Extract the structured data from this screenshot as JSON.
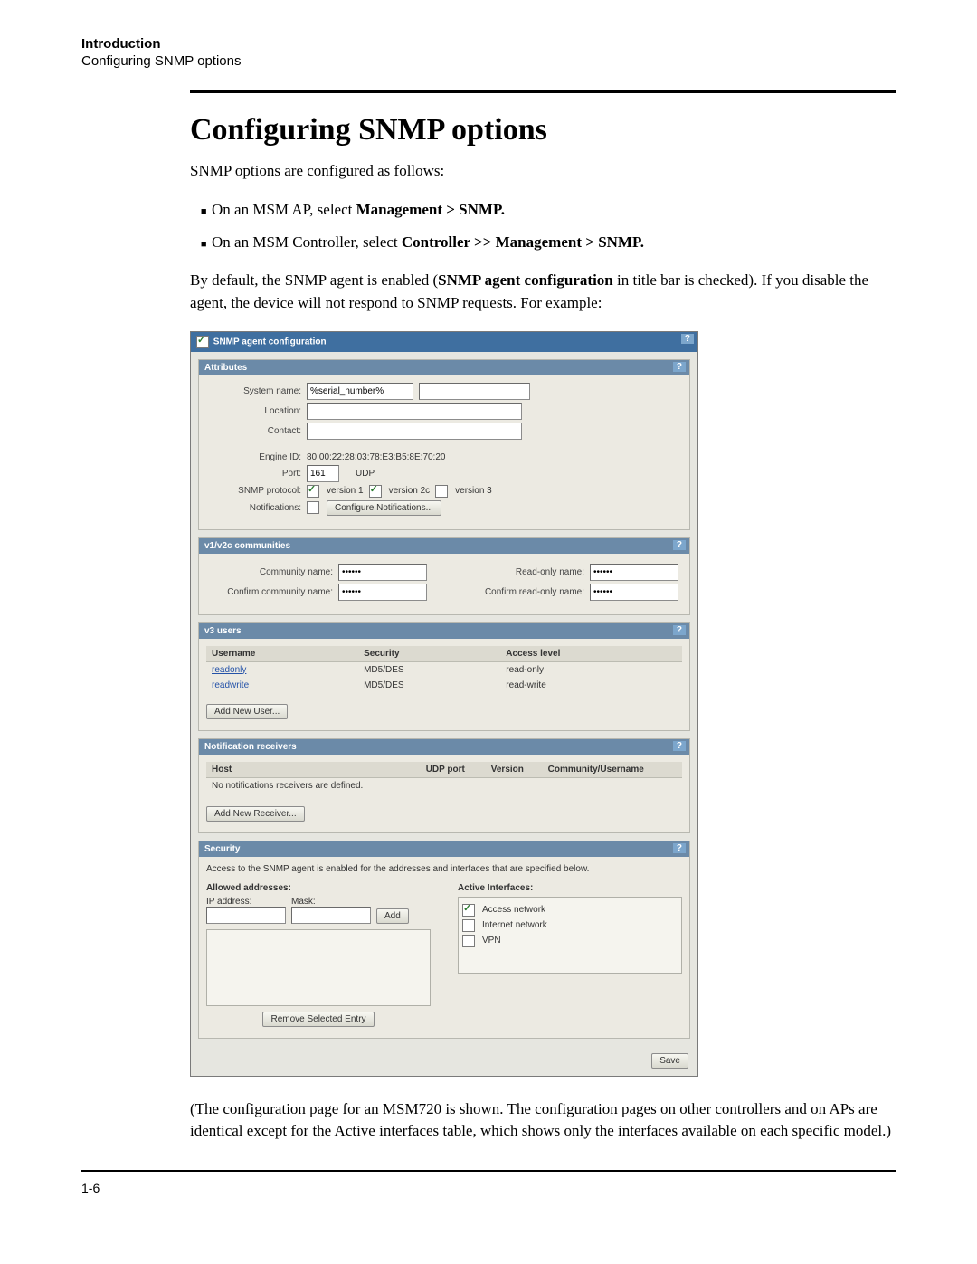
{
  "header": {
    "chapter": "Introduction",
    "breadcrumb": "Configuring SNMP options"
  },
  "title": "Configuring SNMP options",
  "intro": "SNMP options are configured as follows:",
  "bullets": [
    {
      "pre": "On an MSM AP, select ",
      "bold": "Management > SNMP."
    },
    {
      "pre": "On an MSM Controller, select ",
      "bold": "Controller >> Management > SNMP."
    }
  ],
  "para2_a": "By default, the SNMP agent is enabled (",
  "para2_bold": "SNMP agent configuration",
  "para2_b": " in title bar is checked). If you disable the agent, the device will not respond to SNMP requests. For example:",
  "panel": {
    "title": "SNMP agent configuration",
    "help": "?",
    "attributes": {
      "heading": "Attributes",
      "system_name_label": "System name:",
      "system_name_value": "%serial_number%",
      "location_label": "Location:",
      "contact_label": "Contact:",
      "engine_label": "Engine ID:",
      "engine_value": "80:00:22:28:03:78:E3:B5:8E:70:20",
      "port_label": "Port:",
      "port_value": "161",
      "port_proto": "UDP",
      "snmp_proto_label": "SNMP protocol:",
      "proto": {
        "v1": "version 1",
        "v2c": "version 2c",
        "v3": "version 3"
      },
      "notif_label": "Notifications:",
      "notif_btn": "Configure Notifications..."
    },
    "v1v2c": {
      "heading": "v1/v2c communities",
      "community_label": "Community name:",
      "confirm_community_label": "Confirm community name:",
      "readonly_label": "Read-only name:",
      "confirm_readonly_label": "Confirm read-only name:",
      "mask": "••••••"
    },
    "v3": {
      "heading": "v3 users",
      "cols": {
        "user": "Username",
        "security": "Security",
        "access": "Access level"
      },
      "rows": [
        {
          "user": "readonly",
          "security": "MD5/DES",
          "access": "read-only"
        },
        {
          "user": "readwrite",
          "security": "MD5/DES",
          "access": "read-write"
        }
      ],
      "add_btn": "Add New User..."
    },
    "notif_recv": {
      "heading": "Notification receivers",
      "cols": {
        "host": "Host",
        "udp": "UDP port",
        "version": "Version",
        "comm": "Community/Username"
      },
      "empty": "No notifications receivers are defined.",
      "add_btn": "Add New Receiver..."
    },
    "security": {
      "heading": "Security",
      "note": "Access to the SNMP agent is enabled for the addresses and interfaces that are specified below.",
      "allowed_hdr": "Allowed addresses:",
      "ip_label": "IP address:",
      "mask_label": "Mask:",
      "add_btn": "Add",
      "remove_btn": "Remove Selected Entry",
      "active_hdr": "Active Interfaces:",
      "ifaces": [
        {
          "label": "Access network",
          "checked": true
        },
        {
          "label": "Internet network",
          "checked": false
        },
        {
          "label": "VPN",
          "checked": false
        }
      ]
    },
    "save": "Save"
  },
  "tail": "(The configuration page for an MSM720 is shown. The configuration pages on other controllers and on APs are identical except for the Active interfaces table, which shows only the interfaces available on each specific model.)",
  "pagenum": "1-6"
}
